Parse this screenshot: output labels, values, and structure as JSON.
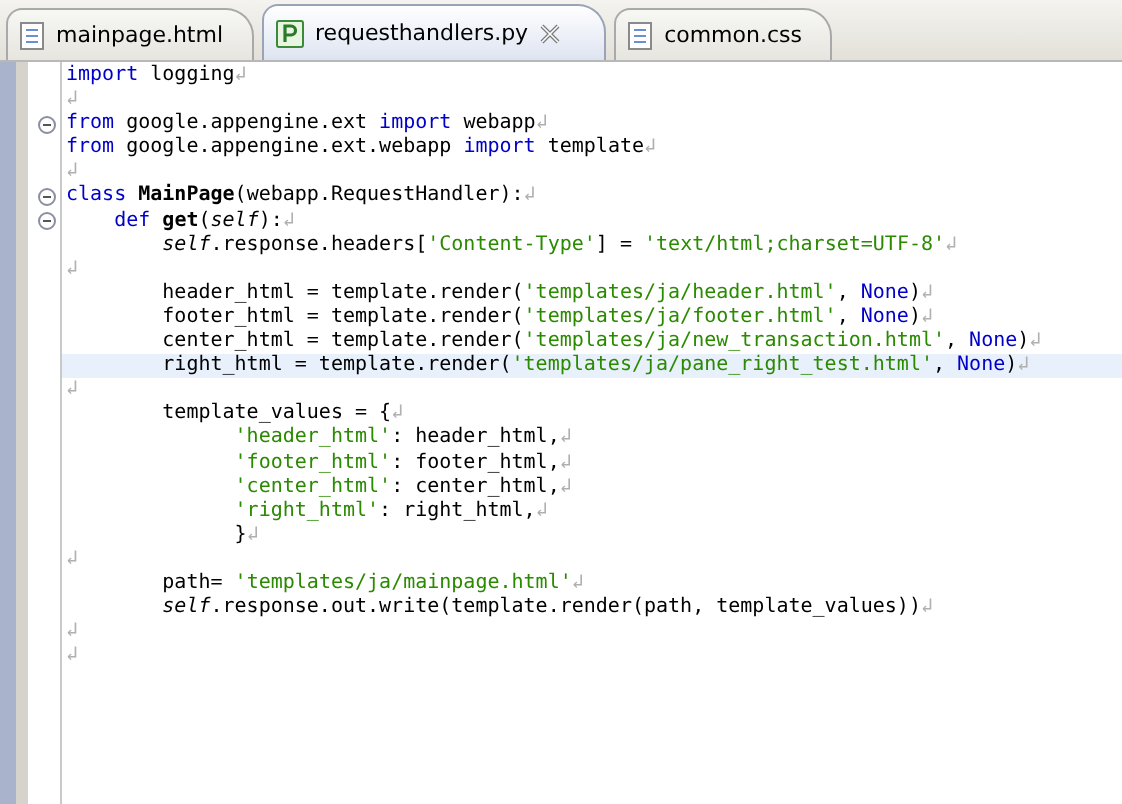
{
  "tabs": [
    {
      "label": "mainpage.html",
      "selected": false
    },
    {
      "label": "requesthandlers.py",
      "selected": true
    },
    {
      "label": "common.css",
      "selected": false
    }
  ],
  "editor": {
    "lines": [
      {
        "fold": false,
        "highlighted": false,
        "tokens": [
          {
            "kind": "keyword",
            "text": "import"
          },
          {
            "kind": "plain",
            "text": " logging"
          },
          {
            "kind": "eol",
            "text": "↲"
          }
        ]
      },
      {
        "fold": false,
        "highlighted": false,
        "tokens": [
          {
            "kind": "eol",
            "text": "↲"
          }
        ]
      },
      {
        "fold": true,
        "highlighted": false,
        "tokens": [
          {
            "kind": "keyword",
            "text": "from"
          },
          {
            "kind": "plain",
            "text": " google.appengine.ext "
          },
          {
            "kind": "keyword",
            "text": "import"
          },
          {
            "kind": "plain",
            "text": " webapp"
          },
          {
            "kind": "eol",
            "text": "↲"
          }
        ]
      },
      {
        "fold": false,
        "highlighted": false,
        "tokens": [
          {
            "kind": "keyword",
            "text": "from"
          },
          {
            "kind": "plain",
            "text": " google.appengine.ext.webapp "
          },
          {
            "kind": "keyword",
            "text": "import"
          },
          {
            "kind": "plain",
            "text": " template"
          },
          {
            "kind": "eol",
            "text": "↲"
          }
        ]
      },
      {
        "fold": false,
        "highlighted": false,
        "tokens": [
          {
            "kind": "eol",
            "text": "↲"
          }
        ]
      },
      {
        "fold": true,
        "highlighted": false,
        "tokens": [
          {
            "kind": "keyword",
            "text": "class "
          },
          {
            "kind": "name",
            "text": "MainPage"
          },
          {
            "kind": "plain",
            "text": "(webapp.RequestHandler):"
          },
          {
            "kind": "eol",
            "text": "↲"
          }
        ]
      },
      {
        "fold": true,
        "highlighted": false,
        "tokens": [
          {
            "kind": "keyword",
            "text": "    def "
          },
          {
            "kind": "name",
            "text": "get"
          },
          {
            "kind": "plain",
            "text": "("
          },
          {
            "kind": "self",
            "text": "self"
          },
          {
            "kind": "plain",
            "text": "):"
          },
          {
            "kind": "eol",
            "text": "↲"
          }
        ]
      },
      {
        "fold": false,
        "highlighted": false,
        "tokens": [
          {
            "kind": "self",
            "text": "        self"
          },
          {
            "kind": "plain",
            "text": ".response.headers["
          },
          {
            "kind": "string",
            "text": "'Content-Type'"
          },
          {
            "kind": "plain",
            "text": "] = "
          },
          {
            "kind": "string",
            "text": "'text/html;charset=UTF-8'"
          },
          {
            "kind": "eol",
            "text": "↲"
          }
        ]
      },
      {
        "fold": false,
        "highlighted": false,
        "tokens": [
          {
            "kind": "eol",
            "text": "↲"
          }
        ]
      },
      {
        "fold": false,
        "highlighted": false,
        "tokens": [
          {
            "kind": "plain",
            "text": "        header_html = template.render("
          },
          {
            "kind": "string",
            "text": "'templates/ja/header.html'"
          },
          {
            "kind": "plain",
            "text": ", "
          },
          {
            "kind": "keyword",
            "text": "None"
          },
          {
            "kind": "plain",
            "text": ")"
          },
          {
            "kind": "eol",
            "text": "↲"
          }
        ]
      },
      {
        "fold": false,
        "highlighted": false,
        "tokens": [
          {
            "kind": "plain",
            "text": "        footer_html = template.render("
          },
          {
            "kind": "string",
            "text": "'templates/ja/footer.html'"
          },
          {
            "kind": "plain",
            "text": ", "
          },
          {
            "kind": "keyword",
            "text": "None"
          },
          {
            "kind": "plain",
            "text": ")"
          },
          {
            "kind": "eol",
            "text": "↲"
          }
        ]
      },
      {
        "fold": false,
        "highlighted": false,
        "tokens": [
          {
            "kind": "plain",
            "text": "        center_html = template.render("
          },
          {
            "kind": "string",
            "text": "'templates/ja/new_transaction.html'"
          },
          {
            "kind": "plain",
            "text": ", "
          },
          {
            "kind": "keyword",
            "text": "None"
          },
          {
            "kind": "plain",
            "text": ")"
          },
          {
            "kind": "eol",
            "text": "↲"
          }
        ]
      },
      {
        "fold": false,
        "highlighted": true,
        "tokens": [
          {
            "kind": "plain",
            "text": "        right_html = template.render("
          },
          {
            "kind": "string",
            "text": "'templates/ja/pane_right_test.html'"
          },
          {
            "kind": "plain",
            "text": ", "
          },
          {
            "kind": "keyword",
            "text": "None"
          },
          {
            "kind": "plain",
            "text": ")"
          },
          {
            "kind": "eol",
            "text": "↲"
          }
        ]
      },
      {
        "fold": false,
        "highlighted": false,
        "tokens": [
          {
            "kind": "eol",
            "text": "↲"
          }
        ]
      },
      {
        "fold": false,
        "highlighted": false,
        "tokens": [
          {
            "kind": "plain",
            "text": "        template_values = {"
          },
          {
            "kind": "eol",
            "text": "↲"
          }
        ]
      },
      {
        "fold": false,
        "highlighted": false,
        "tokens": [
          {
            "kind": "string",
            "text": "              'header_html'"
          },
          {
            "kind": "plain",
            "text": ": header_html,"
          },
          {
            "kind": "eol",
            "text": "↲"
          }
        ]
      },
      {
        "fold": false,
        "highlighted": false,
        "tokens": [
          {
            "kind": "string",
            "text": "              'footer_html'"
          },
          {
            "kind": "plain",
            "text": ": footer_html,"
          },
          {
            "kind": "eol",
            "text": "↲"
          }
        ]
      },
      {
        "fold": false,
        "highlighted": false,
        "tokens": [
          {
            "kind": "string",
            "text": "              'center_html'"
          },
          {
            "kind": "plain",
            "text": ": center_html,"
          },
          {
            "kind": "eol",
            "text": "↲"
          }
        ]
      },
      {
        "fold": false,
        "highlighted": false,
        "tokens": [
          {
            "kind": "string",
            "text": "              'right_html'"
          },
          {
            "kind": "plain",
            "text": ": right_html,"
          },
          {
            "kind": "eol",
            "text": "↲"
          }
        ]
      },
      {
        "fold": false,
        "highlighted": false,
        "tokens": [
          {
            "kind": "plain",
            "text": "              }"
          },
          {
            "kind": "eol",
            "text": "↲"
          }
        ]
      },
      {
        "fold": false,
        "highlighted": false,
        "tokens": [
          {
            "kind": "eol",
            "text": "↲"
          }
        ]
      },
      {
        "fold": false,
        "highlighted": false,
        "tokens": [
          {
            "kind": "plain",
            "text": "        path= "
          },
          {
            "kind": "string",
            "text": "'templates/ja/mainpage.html'"
          },
          {
            "kind": "eol",
            "text": "↲"
          }
        ]
      },
      {
        "fold": false,
        "highlighted": false,
        "tokens": [
          {
            "kind": "self",
            "text": "        self"
          },
          {
            "kind": "plain",
            "text": ".response.out.write(template.render(path, template_values))"
          },
          {
            "kind": "eol",
            "text": "↲"
          }
        ]
      },
      {
        "fold": false,
        "highlighted": false,
        "tokens": [
          {
            "kind": "eol",
            "text": "↲"
          }
        ]
      },
      {
        "fold": false,
        "highlighted": false,
        "tokens": [
          {
            "kind": "eol",
            "text": "↲"
          }
        ]
      }
    ]
  }
}
